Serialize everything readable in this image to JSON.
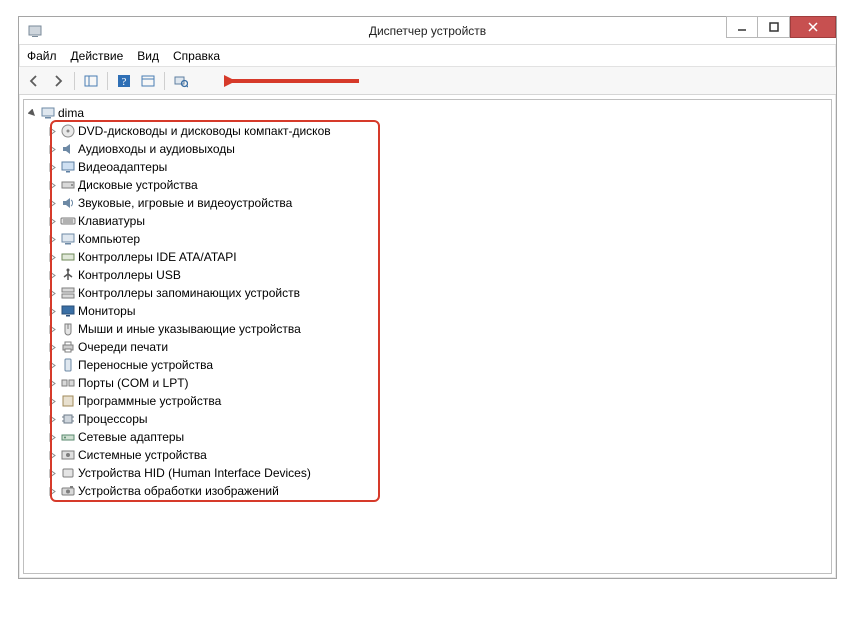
{
  "window": {
    "title": "Диспетчер устройств"
  },
  "menu": {
    "file": "Файл",
    "action": "Действие",
    "view": "Вид",
    "help": "Справка"
  },
  "tree": {
    "root": "dima",
    "items": [
      "DVD-дисководы и дисководы компакт-дисков",
      "Аудиовходы и аудиовыходы",
      "Видеоадаптеры",
      "Дисковые устройства",
      "Звуковые, игровые и видеоустройства",
      "Клавиатуры",
      "Компьютер",
      "Контроллеры IDE ATA/ATAPI",
      "Контроллеры USB",
      "Контроллеры запоминающих устройств",
      "Мониторы",
      "Мыши и иные указывающие устройства",
      "Очереди печати",
      "Переносные устройства",
      "Порты (COM и LPT)",
      "Программные устройства",
      "Процессоры",
      "Сетевые адаптеры",
      "Системные устройства",
      "Устройства HID (Human Interface Devices)",
      "Устройства обработки изображений"
    ]
  },
  "icons": {
    "root": "computer",
    "items": [
      "disc",
      "audio",
      "display",
      "drive",
      "sound",
      "keyboard",
      "computer",
      "ide",
      "usb",
      "storage",
      "monitor",
      "mouse",
      "printer",
      "portable",
      "port",
      "software",
      "cpu",
      "network",
      "system",
      "hid",
      "imaging"
    ]
  }
}
